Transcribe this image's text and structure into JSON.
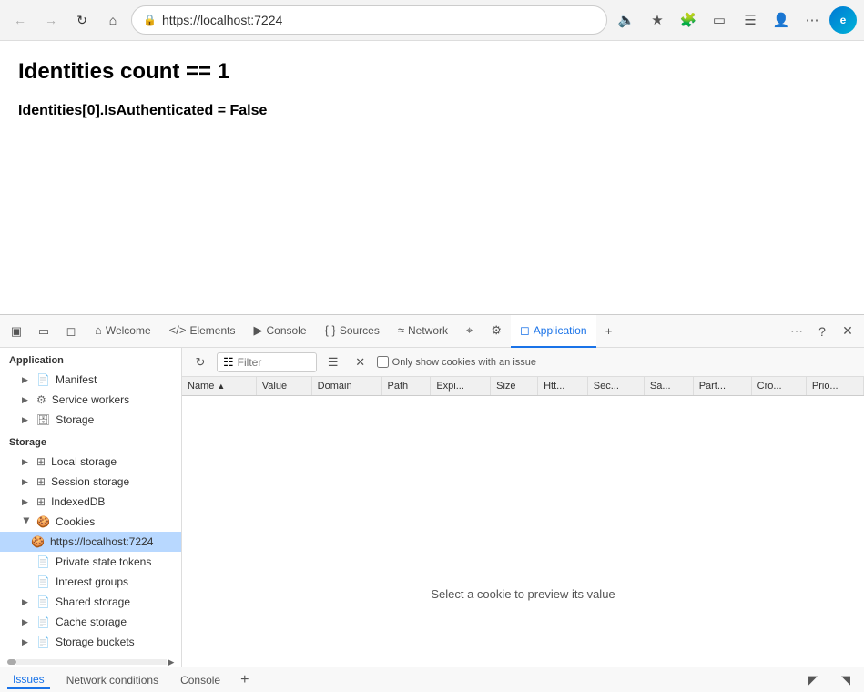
{
  "browser": {
    "url": "https://localhost:7224",
    "back_disabled": true,
    "forward_disabled": true
  },
  "page": {
    "heading": "Identities count == 1",
    "subtext": "Identities[0].IsAuthenticated = False"
  },
  "devtools": {
    "tabs": [
      {
        "id": "welcome",
        "label": "Welcome",
        "icon": "⌂",
        "active": false
      },
      {
        "id": "elements",
        "label": "Elements",
        "icon": "</>",
        "active": false
      },
      {
        "id": "console",
        "label": "Console",
        "icon": "▶",
        "active": false
      },
      {
        "id": "sources",
        "label": "Sources",
        "icon": "{ }",
        "active": false
      },
      {
        "id": "network",
        "label": "Network",
        "icon": "≋",
        "active": false
      },
      {
        "id": "performance",
        "label": "",
        "icon": "⌖",
        "active": false
      },
      {
        "id": "settings",
        "label": "",
        "icon": "⚙",
        "active": false
      },
      {
        "id": "application",
        "label": "Application",
        "icon": "☐",
        "active": true
      }
    ],
    "sidebar": {
      "section_application": "Application",
      "items_application": [
        {
          "id": "manifest",
          "label": "Manifest",
          "icon": "📄",
          "indent": 1,
          "expanded": false
        },
        {
          "id": "service-workers",
          "label": "Service workers",
          "icon": "⚙",
          "indent": 1,
          "expanded": false
        },
        {
          "id": "storage",
          "label": "Storage",
          "icon": "🗄",
          "indent": 1,
          "expanded": false
        }
      ],
      "section_storage": "Storage",
      "items_storage": [
        {
          "id": "local-storage",
          "label": "Local storage",
          "icon": "⊞",
          "indent": 1,
          "expanded": false,
          "has_arrow": true
        },
        {
          "id": "session-storage",
          "label": "Session storage",
          "icon": "⊞",
          "indent": 1,
          "expanded": false,
          "has_arrow": true
        },
        {
          "id": "indexed-db",
          "label": "IndexedDB",
          "icon": "⊞",
          "indent": 1,
          "expanded": false,
          "has_arrow": true
        },
        {
          "id": "cookies",
          "label": "Cookies",
          "icon": "🍪",
          "indent": 1,
          "expanded": true,
          "has_arrow": true
        },
        {
          "id": "cookies-localhost",
          "label": "https://localhost:7224",
          "icon": "🍪",
          "indent": 2,
          "selected": true
        },
        {
          "id": "private-state-tokens",
          "label": "Private state tokens",
          "icon": "📄",
          "indent": 1
        },
        {
          "id": "interest-groups",
          "label": "Interest groups",
          "icon": "📄",
          "indent": 1
        },
        {
          "id": "shared-storage",
          "label": "Shared storage",
          "icon": "📄",
          "indent": 1,
          "has_arrow": true
        },
        {
          "id": "cache-storage",
          "label": "Cache storage",
          "icon": "📄",
          "indent": 1,
          "has_arrow": true
        },
        {
          "id": "storage-buckets",
          "label": "Storage buckets",
          "icon": "📄",
          "indent": 1,
          "has_arrow": true
        }
      ]
    },
    "cookie_toolbar": {
      "filter_placeholder": "Filter",
      "only_show_issues_label": "Only show cookies with an issue"
    },
    "cookie_table": {
      "columns": [
        "Name",
        "Value",
        "Domain",
        "Path",
        "Expi...",
        "Size",
        "Htt...",
        "Sec...",
        "Sa...",
        "Part...",
        "Cro...",
        "Prio..."
      ],
      "rows": []
    },
    "cookie_select_message": "Select a cookie to preview its value",
    "bottom_tabs": [
      "Issues",
      "Network conditions",
      "Console"
    ]
  }
}
